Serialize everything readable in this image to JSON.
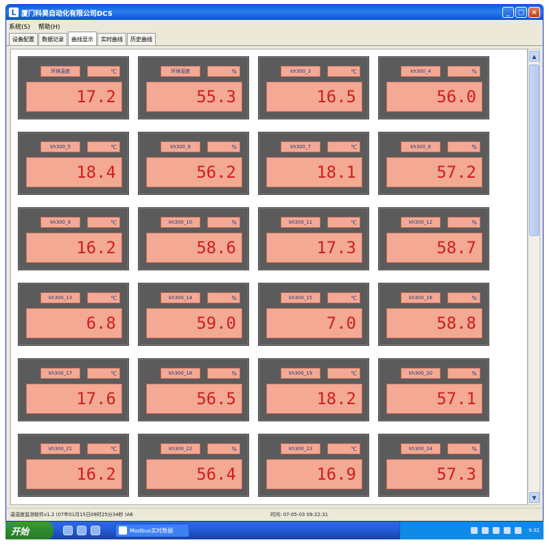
{
  "window": {
    "title": "厦门科昊自动化有限公司DCS"
  },
  "menu": [
    "系统(S)",
    "帮助(H)"
  ],
  "tabs": [
    {
      "label": "设备配置",
      "active": false
    },
    {
      "label": "数据记录",
      "active": false
    },
    {
      "label": "曲线显示",
      "active": true
    },
    {
      "label": "实时曲线",
      "active": false
    },
    {
      "label": "历史曲线",
      "active": false
    }
  ],
  "panels": [
    {
      "name": "环境温度",
      "unit": "℃",
      "value": "17.2"
    },
    {
      "name": "环境湿度",
      "unit": "%",
      "value": "55.3"
    },
    {
      "name": "kh300_3",
      "unit": "℃",
      "value": "16.5"
    },
    {
      "name": "kh300_4",
      "unit": "%",
      "value": "56.0"
    },
    {
      "name": "kh300_5",
      "unit": "℃",
      "value": "18.4"
    },
    {
      "name": "kh300_6",
      "unit": "%",
      "value": "56.2"
    },
    {
      "name": "kh300_7",
      "unit": "℃",
      "value": "18.1"
    },
    {
      "name": "kh300_8",
      "unit": "%",
      "value": "57.2"
    },
    {
      "name": "kh300_9",
      "unit": "℃",
      "value": "16.2"
    },
    {
      "name": "kh300_10",
      "unit": "%",
      "value": "58.6"
    },
    {
      "name": "kh300_11",
      "unit": "℃",
      "value": "17.3"
    },
    {
      "name": "kh300_12",
      "unit": "%",
      "value": "58.7"
    },
    {
      "name": "kh300_13",
      "unit": "℃",
      "value": "6.8"
    },
    {
      "name": "kh300_14",
      "unit": "%",
      "value": "59.0"
    },
    {
      "name": "kh300_15",
      "unit": "℃",
      "value": "7.0"
    },
    {
      "name": "kh300_16",
      "unit": "%",
      "value": "58.8"
    },
    {
      "name": "kh300_17",
      "unit": "℃",
      "value": "17.6"
    },
    {
      "name": "kh300_18",
      "unit": "%",
      "value": "56.5"
    },
    {
      "name": "kh300_19",
      "unit": "℃",
      "value": "18.2"
    },
    {
      "name": "kh300_20",
      "unit": "%",
      "value": "57.1"
    },
    {
      "name": "kh300_21",
      "unit": "℃",
      "value": "16.2"
    },
    {
      "name": "kh300_22",
      "unit": "%",
      "value": "56.4"
    },
    {
      "name": "kh300_23",
      "unit": "℃",
      "value": "16.9"
    },
    {
      "name": "kh300_24",
      "unit": "%",
      "value": "57.3"
    }
  ],
  "status": {
    "left": "温湿度监测软件v1.2 (07年01月15日09时25分34秒 )A6",
    "right": "时间: 07-05-03 09:22:31"
  },
  "taskbar": {
    "start_label": "开始",
    "task_label": "Modbus实时数据",
    "clock": "9:32"
  },
  "colors": {
    "panel_bg": "#5b5b5b",
    "display_bg": "#f3a994",
    "value_text": "#d31c1c",
    "label_text": "#203a7a"
  }
}
